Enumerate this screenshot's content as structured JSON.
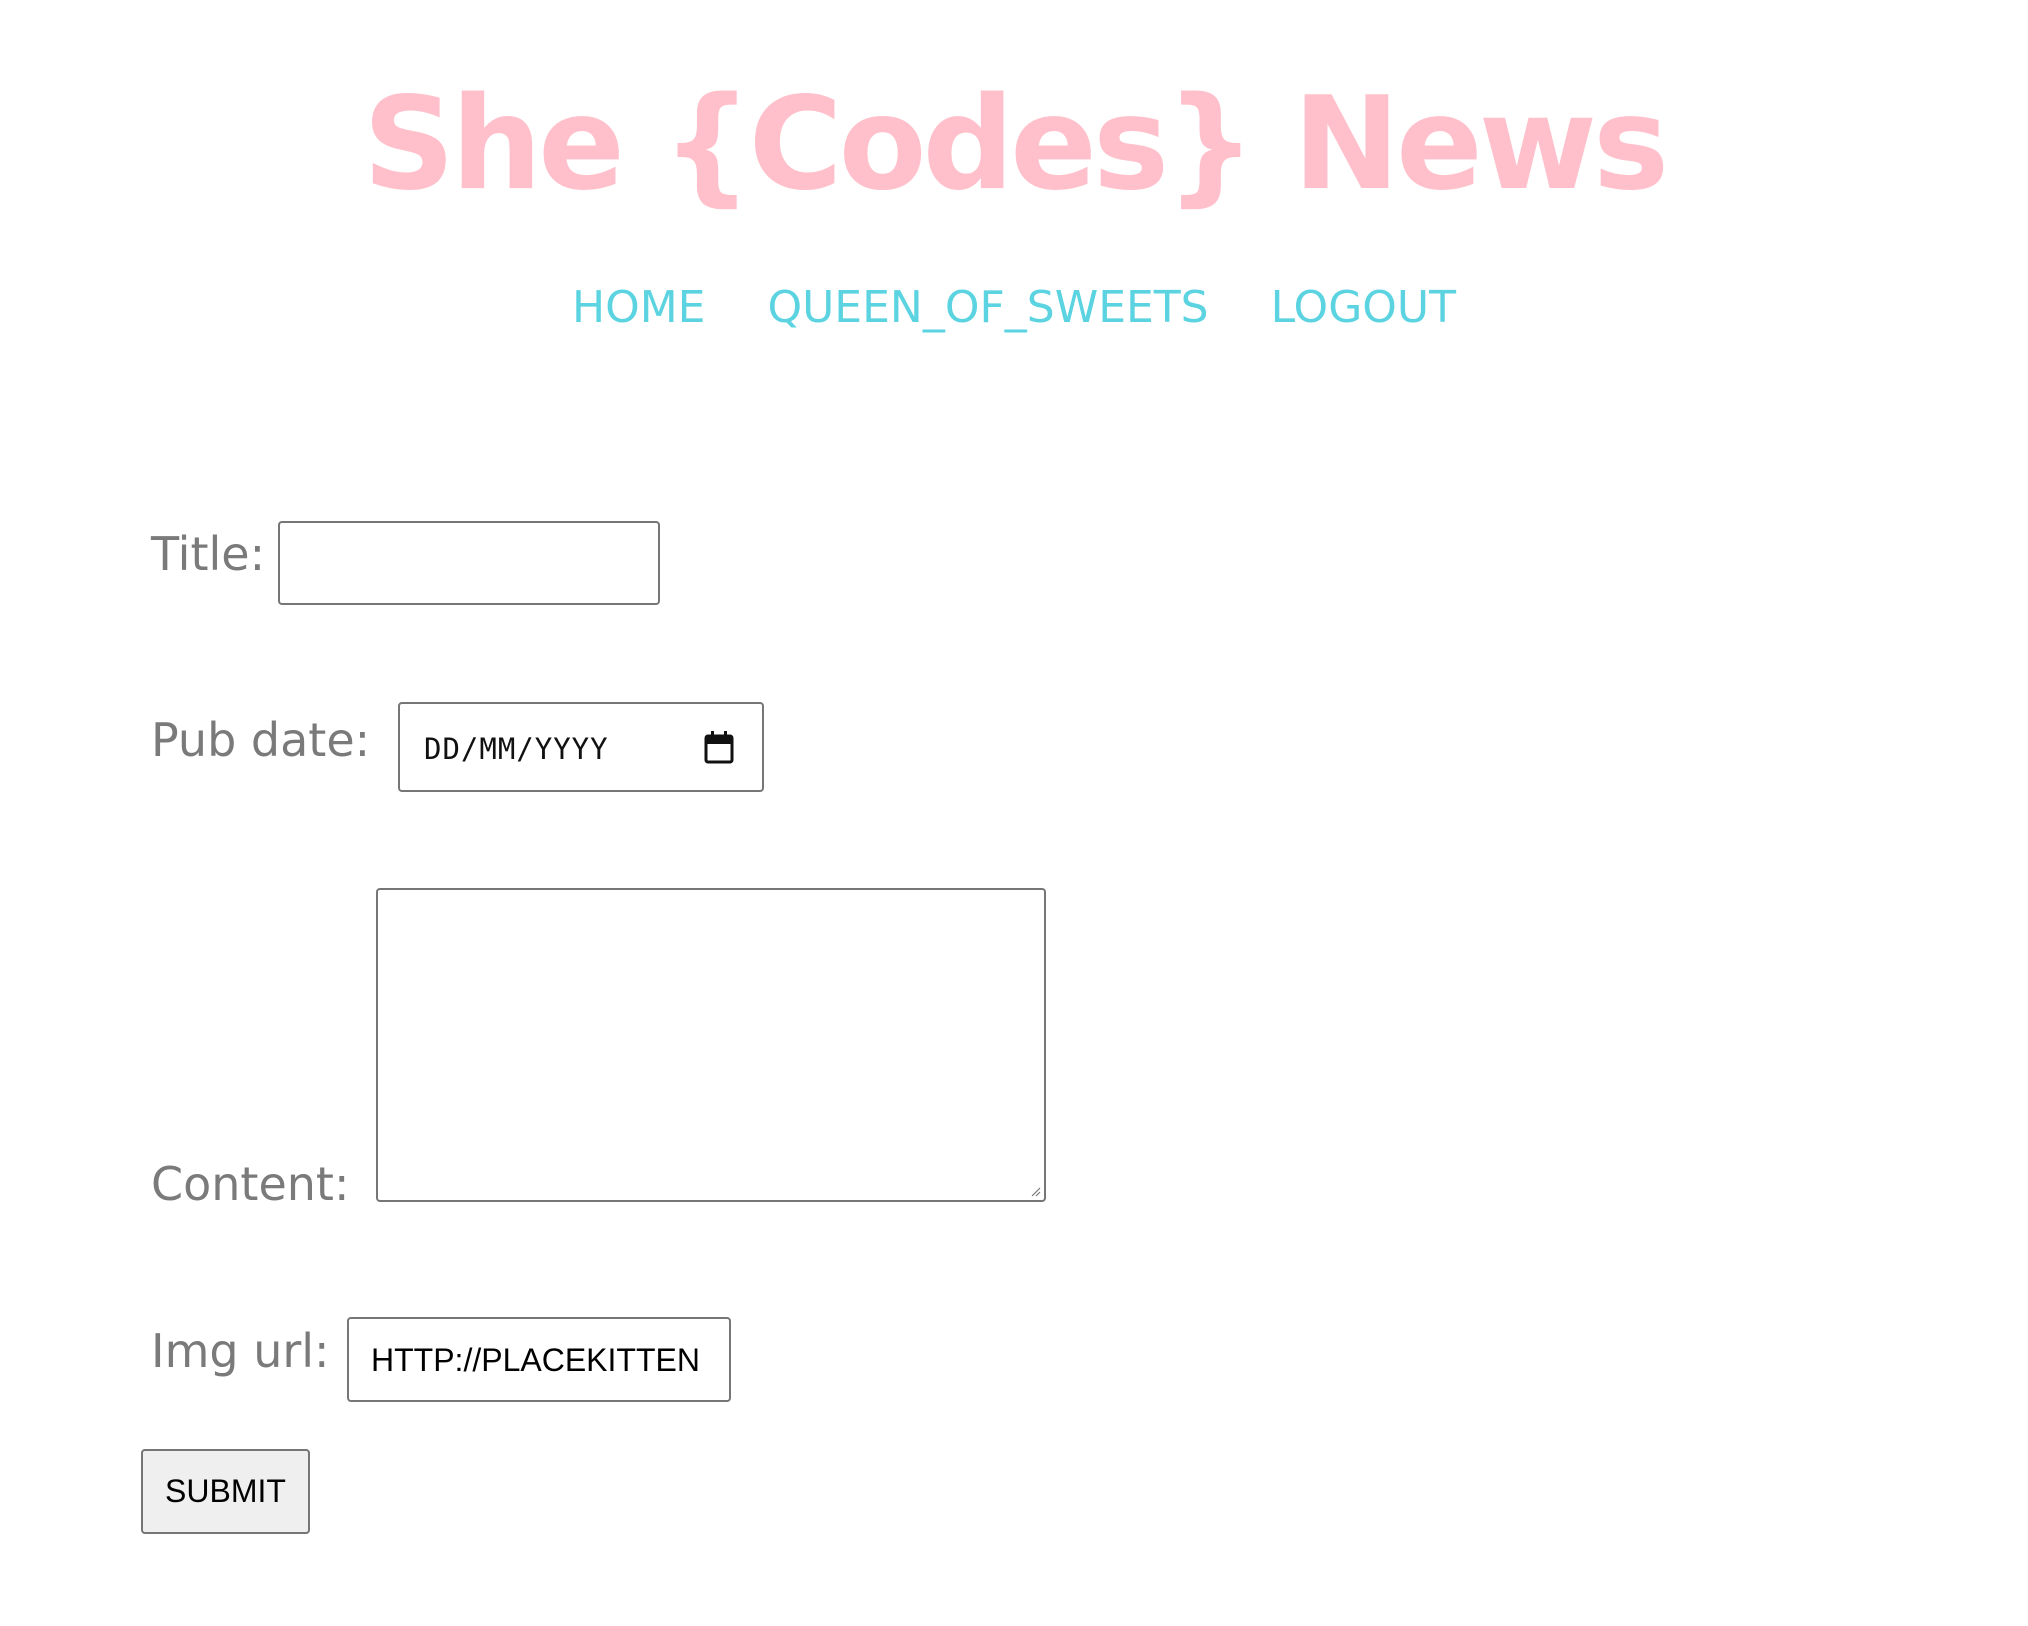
{
  "header": {
    "site_title": "She {Codes} News",
    "title_color": "#ffc0cb"
  },
  "nav": {
    "color": "#5bd3e0",
    "items": [
      {
        "label": "HOME"
      },
      {
        "label": "QUEEN_OF_SWEETS"
      },
      {
        "label": "LOGOUT"
      }
    ]
  },
  "form": {
    "title_label": "Title:",
    "title_value": "",
    "pub_date_label": "Pub date:",
    "pub_date_placeholder": "DD/MM/YYYY",
    "content_label": "Content:",
    "content_value": "",
    "img_url_label": "Img url:",
    "img_url_value": "HTTP://PLACEKITTEN",
    "submit_label": "SUBMIT"
  },
  "icons": {
    "calendar": "calendar-icon",
    "resize": "resize-handle-icon"
  }
}
